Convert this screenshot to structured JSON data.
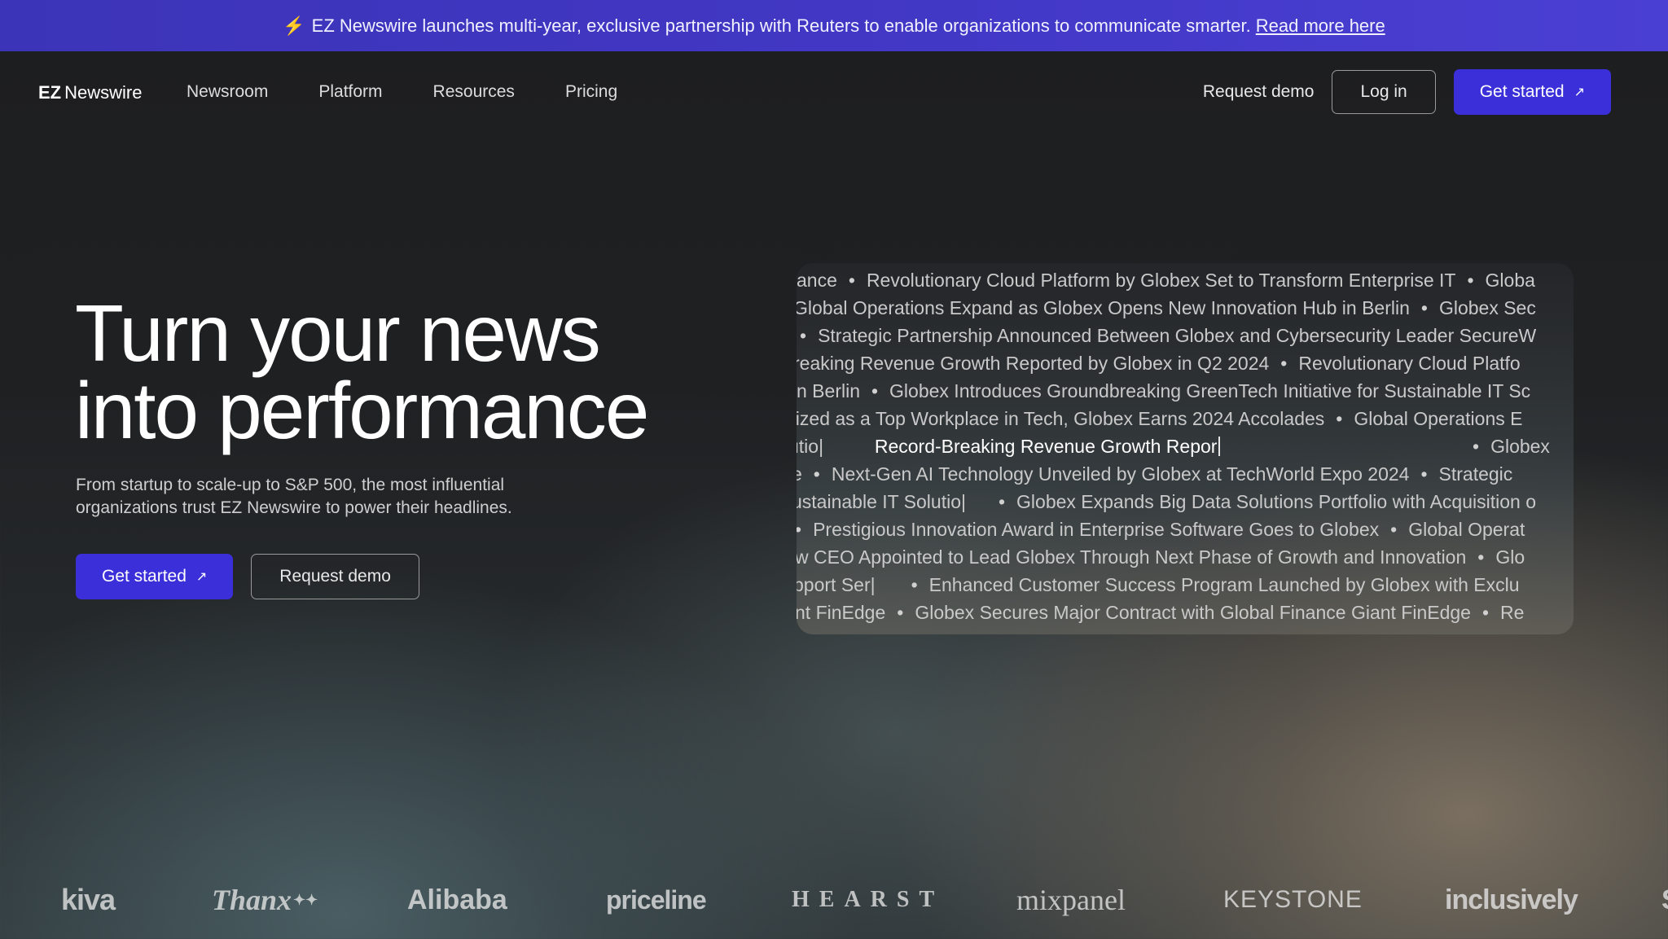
{
  "announcement": {
    "icon": "lightning-icon",
    "text": "EZ Newswire launches multi-year, exclusive partnership with Reuters to enable organizations to communicate smarter.",
    "link": "Read more here"
  },
  "nav": {
    "logo_bold": "EZ",
    "logo_text": "Newswire",
    "links": [
      "Newsroom",
      "Platform",
      "Resources",
      "Pricing"
    ],
    "request_demo": "Request demo",
    "login": "Log in",
    "get_started": "Get started",
    "arrow": "↗"
  },
  "hero": {
    "title_line1": "Turn your news",
    "title_line2": "into performance",
    "subtitle_line1": "From startup to scale-up to S&P 500, the most influential",
    "subtitle_line2": "organizations trust EZ Newswire to power their headlines.",
    "cta_primary": "Get started",
    "cta_secondary": "Request demo",
    "arrow": "↗"
  },
  "headlines": {
    "rows": [
      [
        "ance",
        "Revolutionary Cloud Platform by Globex Set to Transform Enterprise IT",
        "Globa"
      ],
      [
        "Global Operations Expand as Globex Opens New Innovation Hub in Berlin",
        "Globex Sec"
      ],
      [
        "",
        "Strategic Partnership Announced Between Globex and Cybersecurity Leader SecureW"
      ],
      [
        "reaking Revenue Growth Reported by Globex in Q2 2024",
        "Revolutionary Cloud Platfo"
      ],
      [
        "n Berlin",
        "Globex Introduces Groundbreaking GreenTech Initiative for Sustainable IT Sc"
      ],
      [
        "nized as a Top Workplace in Tech, Globex Earns 2024 Accolades",
        "Global Operations E"
      ],
      [
        "e",
        "Next-Gen AI Technology Unveiled by Globex at TechWorld Expo 2024",
        "Strategic"
      ],
      [
        "ustainable IT Solutio|",
        "Globex Expands Big Data Solutions Portfolio with Acquisition o"
      ],
      [
        "",
        "Prestigious Innovation Award in Enterprise Software Goes to Globex",
        "Global Operat"
      ],
      [
        "w CEO Appointed to Lead Globex Through Next Phase of Growth and Innovation",
        "Glo"
      ],
      [
        "pport Ser|",
        "Enhanced Customer Success Program Launched by Globex with Exclu"
      ],
      [
        "nt FinEdge",
        "Globex Secures Major Contract with Global Finance Giant FinEdge",
        "Re"
      ]
    ],
    "typing_row": {
      "left": "utio|",
      "active": "Record-Breaking Revenue Growth Repor",
      "right": "Globex"
    },
    "separator": "•"
  },
  "logos": [
    "kiva",
    "Thanx",
    "Alibaba",
    "priceline",
    "HEARST",
    "mixpanel",
    "KEYSTONE",
    "inclusively",
    "S"
  ],
  "colors": {
    "accent": "#3a2fd8",
    "announcement_bg": "#4137c4",
    "background": "#1f2022"
  }
}
